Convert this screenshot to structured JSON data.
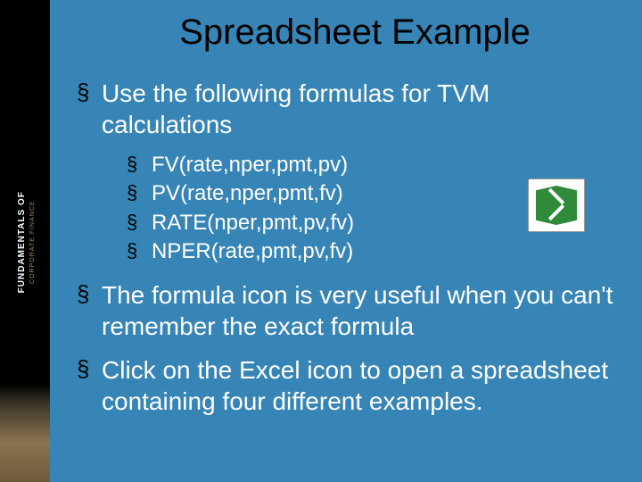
{
  "sidebar": {
    "line1": "FUNDAMENTALS OF",
    "line2": "CORPORATE FINANCE"
  },
  "title": "Spreadsheet Example",
  "bullets": [
    {
      "text": "Use the following formulas for TVM calculations",
      "children": [
        "FV(rate,nper,pmt,pv)",
        "PV(rate,nper,pmt,fv)",
        "RATE(nper,pmt,pv,fv)",
        "NPER(rate,pmt,pv,fv)"
      ]
    },
    {
      "text": "The formula icon is very useful when you can't remember the exact formula"
    },
    {
      "text": "Click on the Excel icon to open a spreadsheet containing four different examples."
    }
  ],
  "icon": {
    "name": "excel-icon"
  }
}
